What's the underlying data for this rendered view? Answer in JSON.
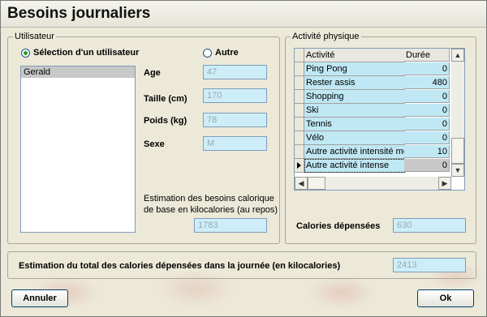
{
  "window": {
    "title": "Besoins journaliers"
  },
  "user_group": {
    "legend": "Utilisateur",
    "select_user_label": "Sélection d'un utilisateur",
    "other_label": "Autre",
    "users": [
      "Gerald"
    ],
    "age_label": "Age",
    "age_value": "47",
    "height_label": "Taille (cm)",
    "height_value": "170",
    "weight_label": "Poids (kg)",
    "weight_value": "78",
    "sex_label": "Sexe",
    "sex_value": "M",
    "base_estimate_label_line1": "Estimation des besoins calorique",
    "base_estimate_label_line2": "de base en kilocalories (au repos)",
    "base_estimate_value": "1783"
  },
  "activity_group": {
    "legend": "Activité physique",
    "columns": {
      "activity": "Activité",
      "duration": "Durée (mm)"
    },
    "rows": [
      {
        "activity": "Ping Pong",
        "duration": "0"
      },
      {
        "activity": "Rester assis",
        "duration": "480"
      },
      {
        "activity": "Shopping",
        "duration": "0"
      },
      {
        "activity": "Ski",
        "duration": "0"
      },
      {
        "activity": "Tennis",
        "duration": "0"
      },
      {
        "activity": "Vélo",
        "duration": "0"
      },
      {
        "activity": "Autre activité intensité mo",
        "duration": "10"
      },
      {
        "activity": "Autre activité intense",
        "duration": "0"
      }
    ],
    "calories_label": "Calories dépensées",
    "calories_value": "630"
  },
  "total": {
    "label": "Estimation du total des calories dépensées dans la journée (en kilocalories)",
    "value": "2413"
  },
  "buttons": {
    "cancel": "Annuler",
    "ok": "Ok"
  },
  "colors": {
    "field_bg": "#cdeef8",
    "cell_bg": "#bfe8f4",
    "accent_border": "#003c74"
  }
}
